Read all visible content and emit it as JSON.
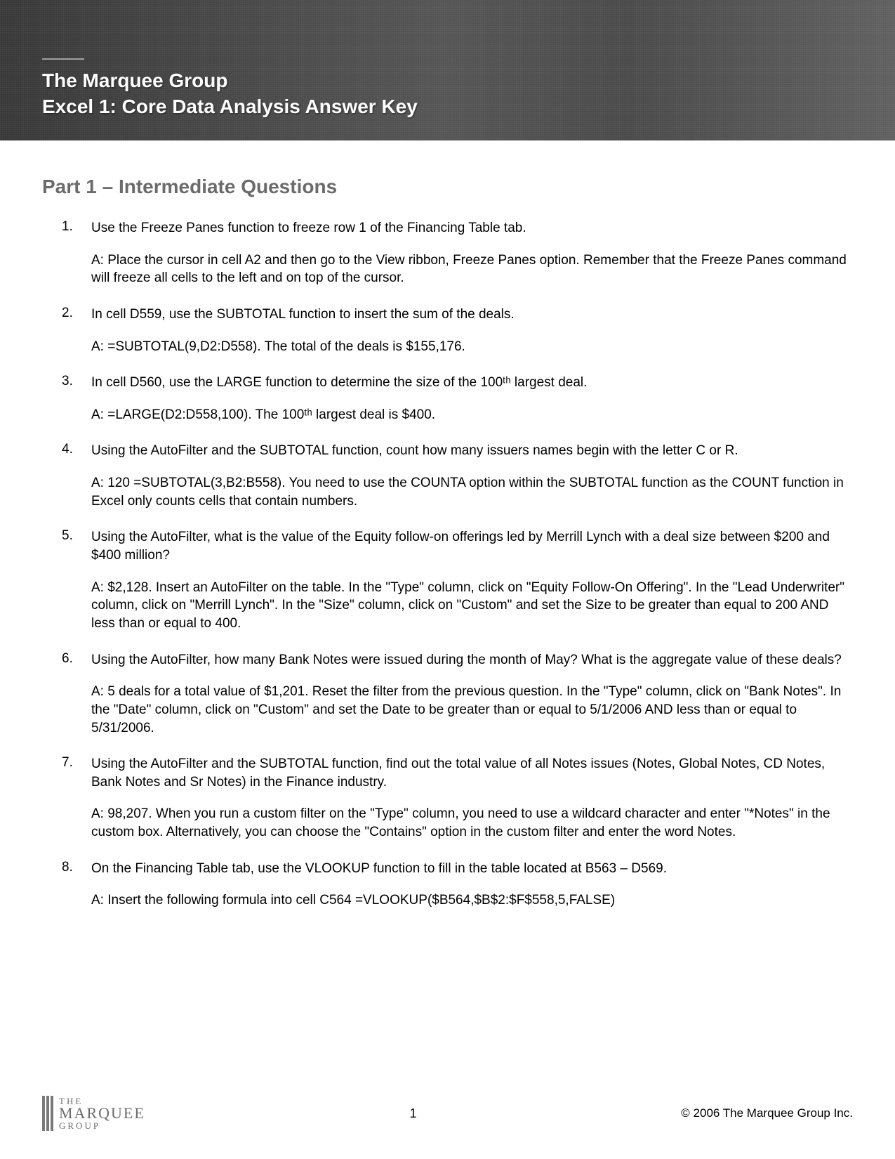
{
  "banner": {
    "title": "The Marquee Group",
    "subtitle": "Excel 1: Core Data Analysis Answer Key"
  },
  "section": {
    "heading": "Part 1 – Intermediate Questions"
  },
  "questions": [
    {
      "num": "1.",
      "q": "Use the Freeze Panes function to freeze row 1 of the Financing Table tab.",
      "a": "A: Place the cursor in cell A2 and then go to the View ribbon, Freeze Panes option.  Remember that the Freeze Panes command will freeze all cells to the left and on top of the cursor."
    },
    {
      "num": "2.",
      "q": "In cell D559, use the SUBTOTAL function to insert the sum of the deals.",
      "a": "A:  =SUBTOTAL(9,D2:D558).  The total of the deals is $155,176."
    },
    {
      "num": "3.",
      "q": "In cell D560, use the LARGE function to determine the size of the 100ᵗʰ largest deal.",
      "a": "A:  =LARGE(D2:D558,100).  The 100ᵗʰ largest deal is $400."
    },
    {
      "num": "4.",
      "q": "Using the AutoFilter and the SUBTOTAL function, count how many issuers names begin with the letter C or R.",
      "a": "A:  120   =SUBTOTAL(3,B2:B558).  You need to use the COUNTA option within the SUBTOTAL function as the COUNT function in Excel only counts cells that contain numbers."
    },
    {
      "num": "5.",
      "q": "Using the AutoFilter, what is the value of the Equity follow-on offerings led by Merrill Lynch with a deal size between $200 and $400 million?",
      "a": "A:  $2,128.  Insert an AutoFilter on the table.  In the \"Type\" column, click on \"Equity Follow-On Offering\".  In the \"Lead Underwriter\" column, click on \"Merrill Lynch\".  In the \"Size\" column, click on \"Custom\" and set the Size to be greater than equal to 200 AND less than or equal to 400."
    },
    {
      "num": "6.",
      "q": "Using the AutoFilter, how many Bank Notes were issued during the month of May?  What is the aggregate value of these deals?",
      "a": "A:  5 deals for a total value of $1,201.  Reset the filter from the previous question.  In the \"Type\" column, click on \"Bank Notes\".  In the \"Date\" column, click on \"Custom\" and set the Date to be greater than or equal to 5/1/2006 AND less than or equal to 5/31/2006."
    },
    {
      "num": "7.",
      "q": "Using the AutoFilter and the SUBTOTAL function, find out the total value of all Notes issues (Notes, Global Notes, CD Notes, Bank Notes and Sr Notes) in the Finance industry.",
      "a": "A:  98,207.  When you run a custom filter on the \"Type\" column, you need to use a wildcard character and enter \"*Notes\" in the custom box.  Alternatively, you can choose the \"Contains\" option in the custom filter and enter the word Notes."
    },
    {
      "num": "8.",
      "q": "On the Financing Table tab, use the VLOOKUP function to fill in the table located at B563 – D569.",
      "a": "A:  Insert the following formula into cell C564  =VLOOKUP($B564,$B$2:$F$558,5,FALSE)"
    }
  ],
  "footer": {
    "logo": {
      "the": "THE",
      "marquee": "MARQUEE",
      "group": "GROUP"
    },
    "page": "1",
    "copyright": "© 2006 The Marquee Group Inc."
  }
}
